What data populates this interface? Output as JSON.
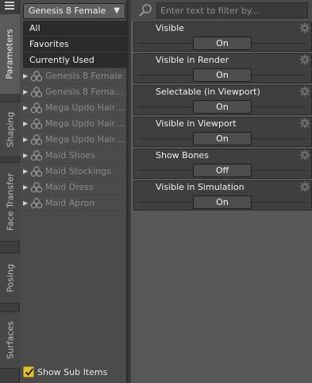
{
  "tabs": [
    {
      "label": "Parameters",
      "active": true
    },
    {
      "label": "Shaping",
      "active": false
    },
    {
      "label": "Face Transfer",
      "active": false
    },
    {
      "label": "Posing",
      "active": false
    },
    {
      "label": "Surfaces",
      "active": false
    }
  ],
  "node_panel": {
    "selected_figure": "Genesis 8 Female",
    "filters": [
      "All",
      "Favorites",
      "Currently Used"
    ],
    "nodes": [
      "Genesis 8 Female",
      "Genesis 8 Female ...",
      "Mega Updo Hair B...",
      "Mega Updo Hair B...",
      "Mega Updo Hair B...",
      "Maid Shoes",
      "Maid Stockings",
      "Maid Dress",
      "Maid Apron"
    ],
    "show_sub_items_label": "Show Sub Items",
    "show_sub_items_checked": true
  },
  "properties": {
    "filter_placeholder": "Enter text to filter by...",
    "items": [
      {
        "name": "Visible",
        "value": "On"
      },
      {
        "name": "Visible in Render",
        "value": "On"
      },
      {
        "name": "Selectable (in Viewport)",
        "value": "On"
      },
      {
        "name": "Visible in Viewport",
        "value": "On"
      },
      {
        "name": "Show Bones",
        "value": "Off"
      },
      {
        "name": "Visible in Simulation",
        "value": "On"
      }
    ]
  },
  "colors": {
    "checkbox_accent": "#e6c229",
    "panel_bg": "#585858",
    "list_bg": "#4b4b4b"
  }
}
